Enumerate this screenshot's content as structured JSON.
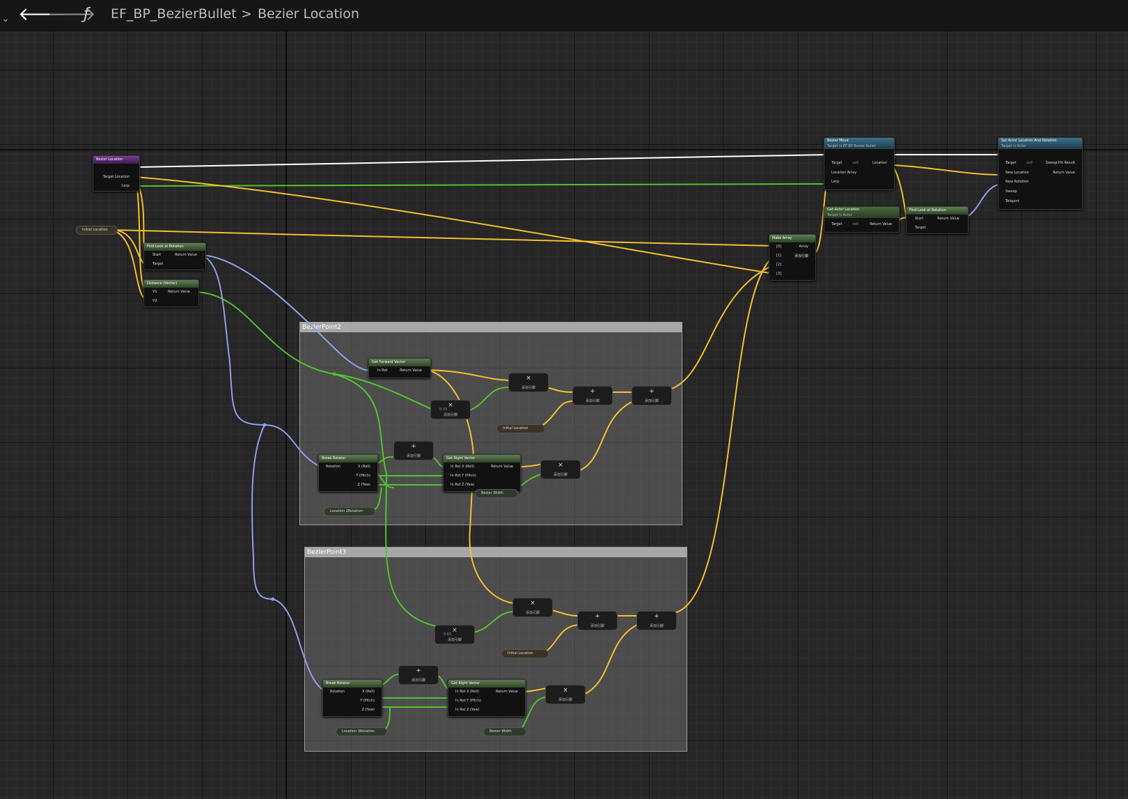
{
  "topbar": {
    "function_icon": "ƒ",
    "blueprint": "EF_BP_BezierBullet",
    "separator": ">",
    "function_name": "Bezier Location",
    "back_icon": "arrow-left-icon",
    "forward_icon": "arrow-right-icon"
  },
  "comments": {
    "c1": "BezierPoint2",
    "c2": "BezierPoint3"
  },
  "nodes": {
    "entry": {
      "title": "Bezier Location",
      "pin_target": "Target Location",
      "pin_lerp": "Lerp"
    },
    "initial_location": "Initial Location",
    "findlook1": {
      "title": "Find Look at Rotation",
      "start": "Start",
      "target": "Target",
      "ret": "Return Value"
    },
    "distance": {
      "title": "Distance (Vector)",
      "v1": "V1",
      "v2": "V2",
      "ret": "Return Value"
    },
    "bezier_move": {
      "title": "Bezier Move",
      "sub": "Target is EF BP Bezier Bullet",
      "target": "Target",
      "self": "self",
      "loc_array": "Location Array",
      "lerp": "Lerp",
      "location": "Location"
    },
    "get_actor_loc": {
      "title": "Get Actor Location",
      "sub": "Target is Actor",
      "target": "Target",
      "self": "self",
      "ret": "Return Value"
    },
    "make_array": {
      "title": "Make Array",
      "p0": "[0]",
      "p1": "[1]",
      "p2": "[2]",
      "p3": "[3]",
      "array": "Array",
      "add": "添加引脚"
    },
    "set_actor": {
      "title": "Set Actor Location And Rotation",
      "sub": "Target is Actor",
      "target": "Target",
      "self": "self",
      "new_loc": "New Location",
      "new_rot": "New Rotation",
      "sweep": "Sweep",
      "teleport": "Teleport",
      "hit": "Sweep Hit Result",
      "ret": "Return Value"
    },
    "findlook2": {
      "title": "Find Look at Rotation",
      "start": "Start",
      "target": "Target",
      "ret": "Return Value"
    },
    "get_forward": {
      "title": "Get Forward Vector",
      "in_rot": "In Rot",
      "ret": "Return Value"
    },
    "break_rot": {
      "title": "Break Rotator",
      "rotation": "Rotation",
      "x": "X (Roll)",
      "y": "Y (Pitch)",
      "z": "Z (Yaw)"
    },
    "get_right": {
      "title": "Get Right Vector",
      "x": "In Rot X (Roll)",
      "y": "In Rot Y (Pitch)",
      "z": "In Rot Z (Yaw)",
      "ret": "Return Value"
    },
    "loc2rot": "Location 2Rotation",
    "loc3rot": "Location 3Rotation",
    "bezier_width": "Bezier Width",
    "mult_val_1": "0.33",
    "mult_val_2": "0.65",
    "add_pin": "添加引脚",
    "mul_glyph": "×",
    "add_glyph": "+"
  },
  "colors": {
    "exec": "#ffffff",
    "vector": "#f2c12e",
    "float": "#53c22f",
    "rotator": "#8fa0e8",
    "background": "#262626"
  }
}
